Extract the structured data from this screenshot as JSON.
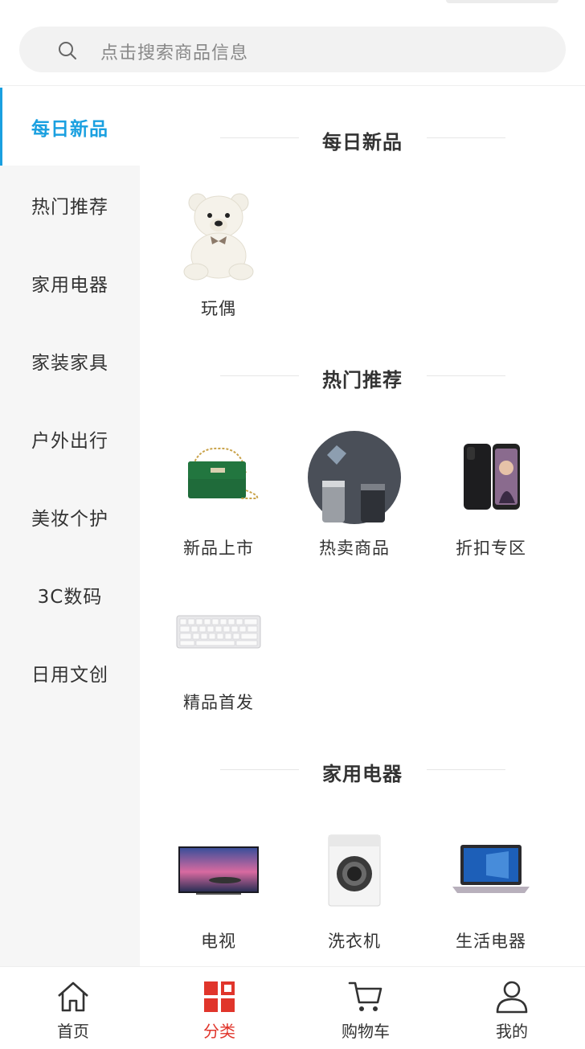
{
  "search": {
    "placeholder": "点击搜索商品信息"
  },
  "sidebar": {
    "items": [
      {
        "label": "每日新品",
        "active": true
      },
      {
        "label": "热门推荐"
      },
      {
        "label": "家用电器"
      },
      {
        "label": "家装家具"
      },
      {
        "label": "户外出行"
      },
      {
        "label": "美妆个护"
      },
      {
        "label": "3C数码"
      },
      {
        "label": "日用文创"
      }
    ]
  },
  "sections": [
    {
      "title": "每日新品",
      "items": [
        {
          "label": "玩偶",
          "icon": "teddy-bear"
        }
      ]
    },
    {
      "title": "热门推荐",
      "items": [
        {
          "label": "新品上市",
          "icon": "green-handbag"
        },
        {
          "label": "热卖商品",
          "icon": "thermos-bottles"
        },
        {
          "label": "折扣专区",
          "icon": "smartphone"
        },
        {
          "label": "精品首发",
          "icon": "keyboard"
        }
      ]
    },
    {
      "title": "家用电器",
      "items": [
        {
          "label": "电视",
          "icon": "television"
        },
        {
          "label": "洗衣机",
          "icon": "washing-machine"
        },
        {
          "label": "生活电器",
          "icon": "laptop"
        }
      ]
    }
  ],
  "tabbar": {
    "items": [
      {
        "label": "首页",
        "icon": "home-icon"
      },
      {
        "label": "分类",
        "icon": "category-icon",
        "active": true
      },
      {
        "label": "购物车",
        "icon": "cart-icon"
      },
      {
        "label": "我的",
        "icon": "user-icon"
      }
    ]
  },
  "colors": {
    "accent": "#1aa0e0",
    "tab_active": "#e0352b"
  }
}
